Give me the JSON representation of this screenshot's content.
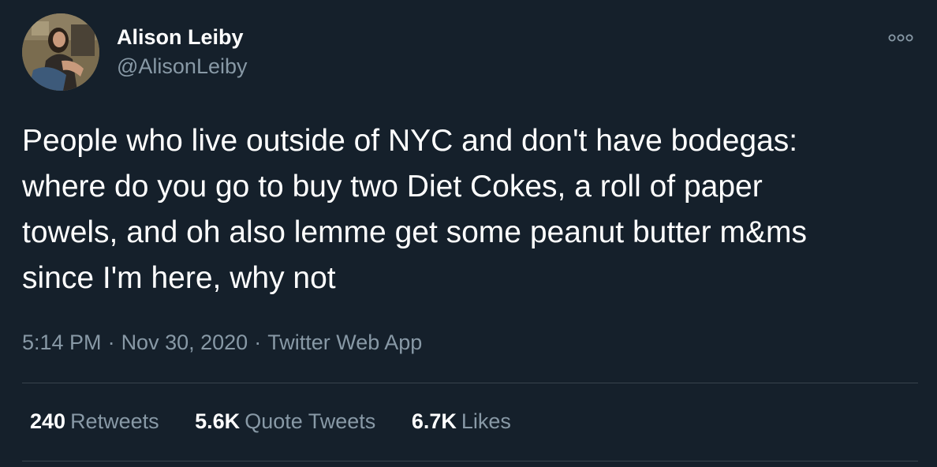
{
  "author": {
    "display_name": "Alison Leiby",
    "handle": "@AlisonLeiby"
  },
  "tweet": {
    "text": "People who live outside of NYC and don't have bodegas:\nwhere do you go to buy two Diet Cokes, a roll of paper\ntowels, and oh also lemme get some peanut butter m&ms\nsince I'm here, why not"
  },
  "meta": {
    "time": "5:14 PM",
    "separator": "·",
    "date": "Nov 30, 2020",
    "source": "Twitter Web App"
  },
  "stats": {
    "retweets": {
      "count": "240",
      "label": "Retweets"
    },
    "quote_tweets": {
      "count": "5.6K",
      "label": "Quote Tweets"
    },
    "likes": {
      "count": "6.7K",
      "label": "Likes"
    }
  },
  "colors": {
    "background": "#15202b",
    "primary_text": "#ffffff",
    "secondary_text": "#8899a6",
    "divider": "#38444d"
  },
  "icons": {
    "more": "more-options-icon"
  }
}
